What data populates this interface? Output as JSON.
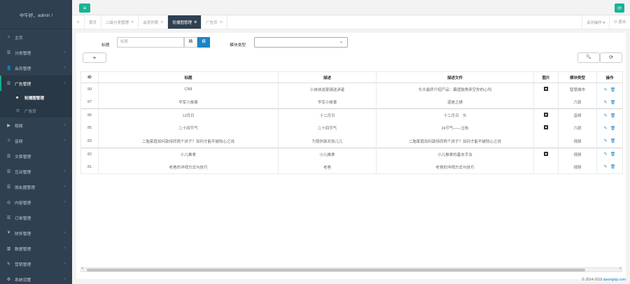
{
  "sidebar": {
    "user": "中午好，admin !",
    "items": [
      {
        "label": "主页",
        "icon": "home-icon",
        "glyph": "⌂",
        "chevron": false
      },
      {
        "label": "分类管理",
        "icon": "list-icon",
        "glyph": "☰",
        "chevron": true
      },
      {
        "label": "会员管理",
        "icon": "user-icon",
        "glyph": "👤",
        "chevron": true
      },
      {
        "label": "广告管理",
        "icon": "ad-icon",
        "glyph": "☰",
        "chevron": true,
        "open": true
      }
    ],
    "subitems": [
      {
        "label": "轮播图管理",
        "icon": "dot-icon",
        "glyph": "■",
        "active": true
      },
      {
        "label": "广告页",
        "icon": "list-icon",
        "glyph": "☰",
        "active": false
      }
    ],
    "items2": [
      {
        "label": "视频",
        "icon": "video-icon",
        "glyph": "▶",
        "chevron": true
      },
      {
        "label": "音频",
        "icon": "audio-icon",
        "glyph": "♫",
        "chevron": true
      },
      {
        "label": "文章管理",
        "icon": "article-icon",
        "glyph": "☰",
        "chevron": false
      },
      {
        "label": "互动管理",
        "icon": "interact-icon",
        "glyph": "☰",
        "chevron": true
      },
      {
        "label": "朋友圈管理",
        "icon": "moments-icon",
        "glyph": "☰",
        "chevron": true
      },
      {
        "label": "内容管理",
        "icon": "content-icon",
        "glyph": "◎",
        "chevron": true
      },
      {
        "label": "订单管理",
        "icon": "order-icon",
        "glyph": "☰",
        "chevron": false
      },
      {
        "label": "财务管理",
        "icon": "finance-icon",
        "glyph": "¥",
        "chevron": true
      },
      {
        "label": "数据管理",
        "icon": "data-icon",
        "glyph": "▥",
        "chevron": true
      },
      {
        "label": "营销管理",
        "icon": "marketing-icon",
        "glyph": "✎",
        "chevron": true
      },
      {
        "label": "系统设置",
        "icon": "settings-icon",
        "glyph": "⚙",
        "chevron": true
      }
    ]
  },
  "topbar": {
    "menu_glyph": "≡",
    "refresh_glyph": "⟳"
  },
  "tabs": {
    "back_glyph": "«",
    "items": [
      {
        "label": "首页",
        "close": "",
        "active": false
      },
      {
        "label": "二级分类管理",
        "close": "⊗",
        "active": false
      },
      {
        "label": "会员列表",
        "close": "⊗",
        "active": false
      },
      {
        "label": "轮播图管理",
        "close": "⊗",
        "active": true
      },
      {
        "label": "广告页",
        "close": "⊗",
        "active": false
      }
    ],
    "close_ops": "关闭操作 ▾",
    "logout": "⏻ 退出"
  },
  "search": {
    "title_label": "标题",
    "title_placeholder": "标题",
    "btn_exact": "精",
    "btn_fuzzy": "模",
    "module_label": "模块类型",
    "select_value": "",
    "select_arrow": "⌄"
  },
  "toolbar": {
    "add": "+",
    "search": "🔍",
    "refresh": "⟳"
  },
  "table": {
    "headers": [
      "ID",
      "标题",
      "描述",
      "描述文件",
      "图片",
      "模块类型",
      "操作"
    ],
    "rows": [
      {
        "id": "90",
        "title": "CR8",
        "desc": "小自侠送豪骑送讲者",
        "file": "头头最挤介绍产品：霸遗独角来空你的心吗",
        "img": true,
        "type": "智慧城市"
      },
      {
        "id": "87",
        "title": "华军小故事",
        "desc": "华军小故事",
        "file": "道是之绩",
        "img": false,
        "type": "六政"
      },
      {
        "id": "86",
        "title": "12月日",
        "desc": "十二月日",
        "file": "十二月日　头",
        "img": true,
        "type": "音频"
      },
      {
        "id": "85",
        "title": "二十四节气",
        "desc": "二十四节气",
        "file": "24节气——立秋",
        "img": true,
        "type": "六政"
      },
      {
        "id": "83",
        "title": "二胎家庭如何敦待同两个孩子？如何才能不被较心之说",
        "desc": "为我你敦对孩儿几",
        "file": "二胎家庭如何敦待同两个孩子？如何才能不被较心之说",
        "img": false,
        "type": "视频"
      },
      {
        "id": "82",
        "title": "小儿推拿",
        "desc": "小儿推拿",
        "file": "小儿推拿的基本手法",
        "img": true,
        "type": "视频"
      },
      {
        "id": "81",
        "title": "老爸的冲视方式与技巧",
        "desc": "老爸",
        "file": "老爸的冲视方式与技巧",
        "img": false,
        "type": "视频"
      }
    ],
    "op_edit": "✎",
    "op_delete": "🗑"
  },
  "scrollbar": {
    "left": "‹",
    "right": "›"
  },
  "footer": {
    "copyright": "© 2014-2015",
    "link": "qwanglup.com"
  }
}
